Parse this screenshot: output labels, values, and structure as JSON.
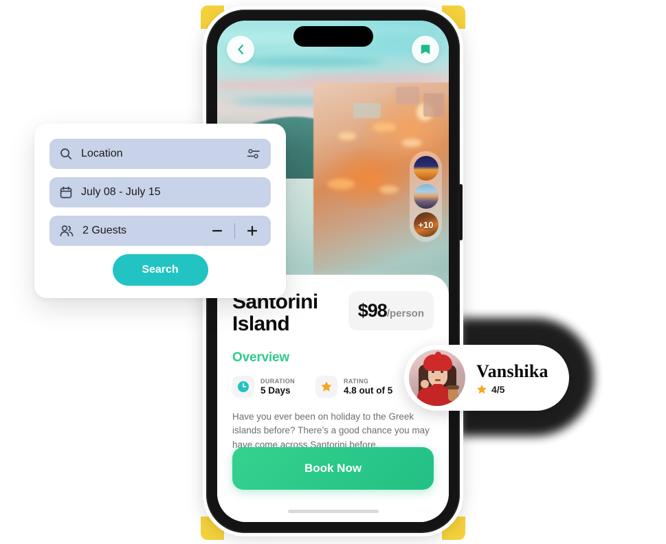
{
  "search_card": {
    "location": {
      "icon": "search-icon",
      "value": "Location",
      "filter_icon": "sliders-icon"
    },
    "dates": {
      "icon": "calendar-icon",
      "value": "July 08 - July 15"
    },
    "guests": {
      "icon": "people-icon",
      "value": "2 Guests",
      "decrement": "−",
      "increment": "+"
    },
    "search_button": "Search",
    "accent_color": "#21C3C3",
    "field_bg": "#C8D2E8"
  },
  "phone": {
    "header": {
      "back_icon": "chevron-left-icon",
      "bookmark_icon": "bookmark-icon"
    },
    "gallery": {
      "thumbnails": [
        "thumb-1",
        "thumb-2",
        "thumb-3"
      ],
      "more_count": "+10"
    },
    "detail": {
      "title": "Santorini Island",
      "price_amount": "$98",
      "price_unit": "/person",
      "overview_heading": "Overview",
      "meta": [
        {
          "icon": "clock-icon",
          "label": "DURATION",
          "value": "5 Days"
        },
        {
          "icon": "star-icon",
          "label": "RATING",
          "value": "4.8 out of 5"
        }
      ],
      "description": "Have you ever been on holiday to the Greek islands before? There’s a good chance you may have come across Santorini before.",
      "book_button": "Book Now",
      "overview_color": "#2FCC8B",
      "book_color": "#25C686"
    }
  },
  "avatar_card": {
    "avatar": "user-avatar",
    "name": "Vanshika",
    "star_icon": "star-icon",
    "rating": "4/5"
  },
  "decor": {
    "accent_yellow": "#F5D23C"
  }
}
